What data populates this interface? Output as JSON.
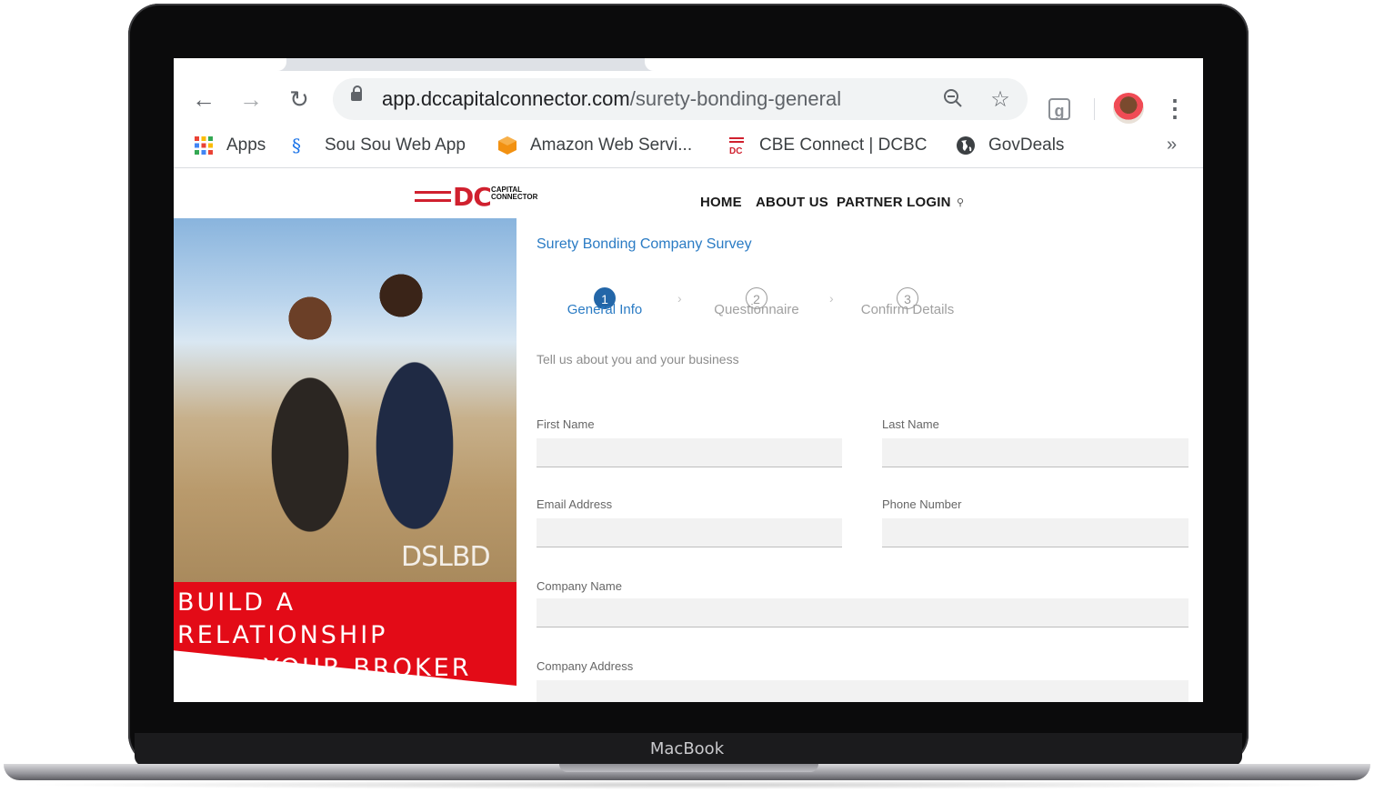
{
  "device": {
    "label": "MacBook"
  },
  "browser": {
    "url_host": "app.dccapitalconnector.com",
    "url_path": "/surety-bonding-general",
    "bookmarks": [
      {
        "label": "Apps",
        "icon": "apps-grid-icon"
      },
      {
        "label": "Sou Sou Web App",
        "icon": "sousou-icon"
      },
      {
        "label": "Amazon Web Servi...",
        "icon": "aws-cube-icon"
      },
      {
        "label": "CBE Connect | DCBC",
        "icon": "dcbc-icon"
      },
      {
        "label": "GovDeals",
        "icon": "globe-icon"
      }
    ],
    "more_bookmarks": "»"
  },
  "site": {
    "logo_text": "DC",
    "logo_sub1": "CAPITAL",
    "logo_sub2": "CONNECTOR",
    "nav": [
      "HOME",
      "ABOUT US",
      "PARTNER LOGIN"
    ],
    "accent_color": "#2a7bc4",
    "brand_red": "#d0202e"
  },
  "hero": {
    "watermark": "DSLBD",
    "banner_line1": "BUILD A RELATIONSHIP",
    "banner_line2": "WITH YOUR BROKER",
    "banner_color": "#e30b17"
  },
  "form": {
    "title": "Surety Bonding Company Survey",
    "steps": [
      {
        "num": "1",
        "label": "General Info",
        "active": true
      },
      {
        "num": "2",
        "label": "Questionnaire",
        "active": false
      },
      {
        "num": "3",
        "label": "Confirm Details",
        "active": false
      }
    ],
    "intro": "Tell us about you and your business",
    "fields": {
      "first_name": "First Name",
      "last_name": "Last Name",
      "email": "Email Address",
      "phone": "Phone Number",
      "company_name": "Company Name",
      "company_address": "Company Address"
    }
  }
}
